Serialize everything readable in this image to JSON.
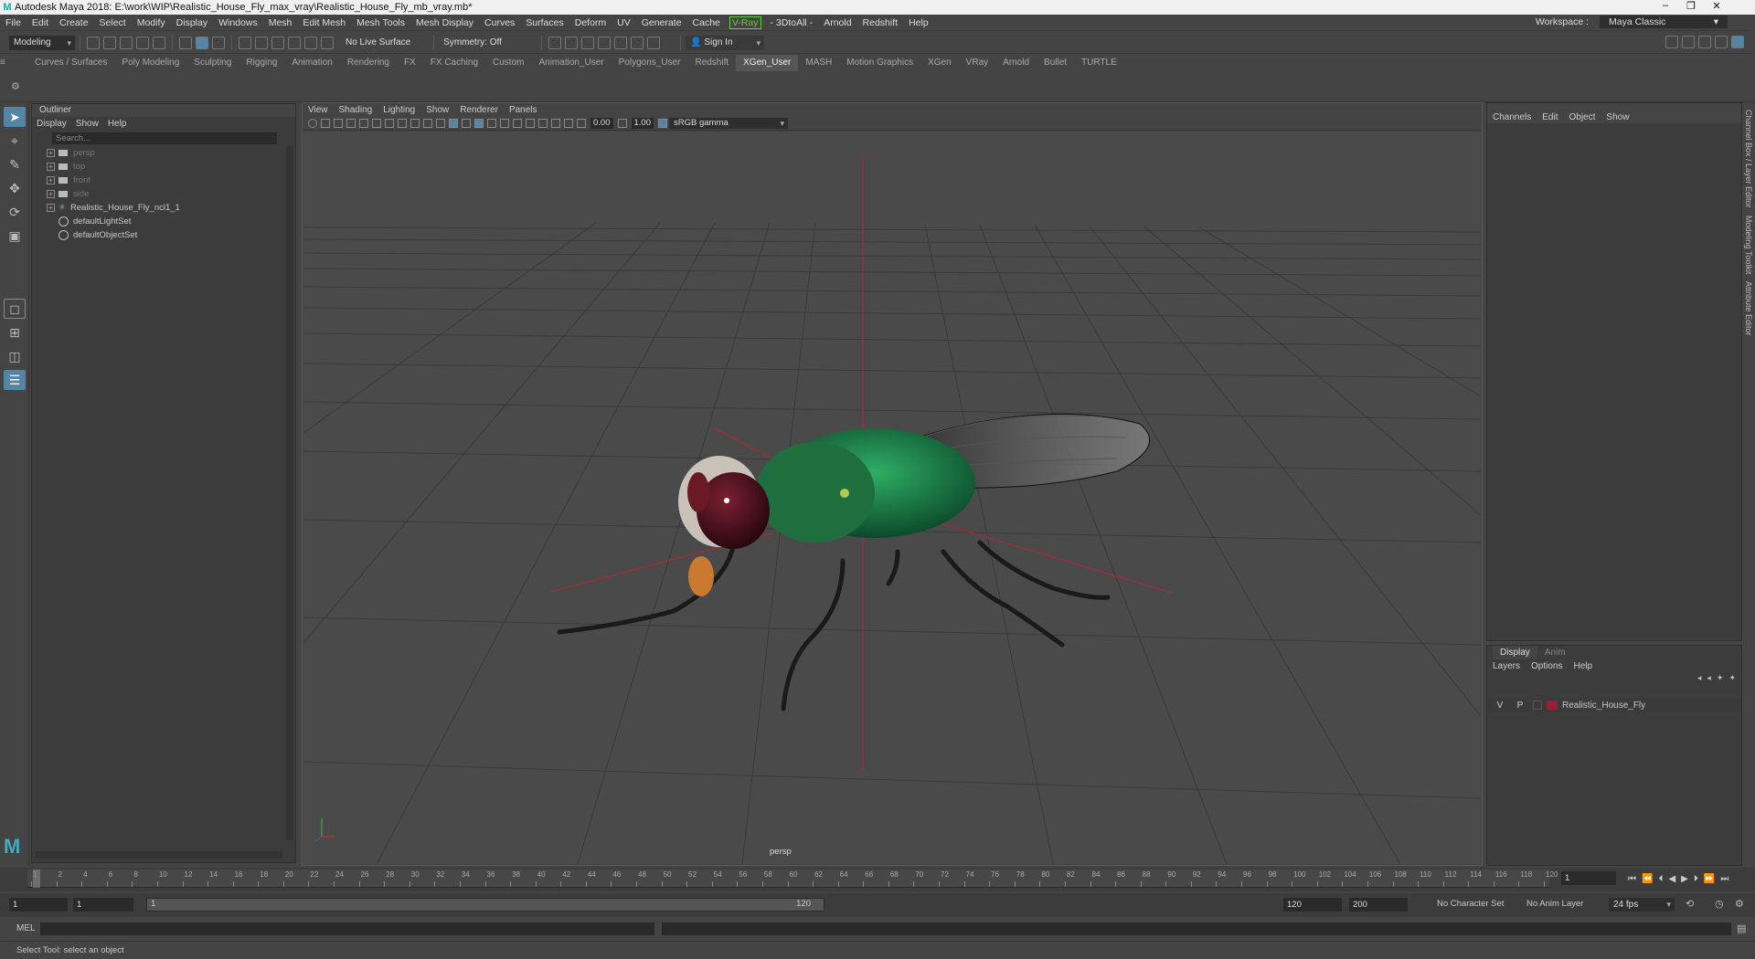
{
  "titlebar": {
    "text": "Autodesk Maya 2018: E:\\work\\WIP\\Realistic_House_Fly_max_vray\\Realistic_House_Fly_mb_vray.mb*"
  },
  "menubar": {
    "items": [
      "File",
      "Edit",
      "Create",
      "Select",
      "Modify",
      "Display",
      "Windows",
      "Mesh",
      "Edit Mesh",
      "Mesh Tools",
      "Mesh Display",
      "Curves",
      "Surfaces",
      "Deform",
      "UV",
      "Generate",
      "Cache"
    ],
    "vray": "V-Ray",
    "items2": [
      "- 3DtoAll -",
      "Arnold",
      "Redshift",
      "Help"
    ],
    "workspace_label": "Workspace :",
    "workspace_value": "Maya Classic"
  },
  "statusline": {
    "mode": "Modeling",
    "live_surface": "No Live Surface",
    "symmetry": "Symmetry: Off",
    "sign_in": "Sign In"
  },
  "shelf": {
    "tabs": [
      "Curves / Surfaces",
      "Poly Modeling",
      "Sculpting",
      "Rigging",
      "Animation",
      "Rendering",
      "FX",
      "FX Caching",
      "Custom",
      "Animation_User",
      "Polygons_User",
      "Redshift",
      "XGen_User",
      "MASH",
      "Motion Graphics",
      "XGen",
      "VRay",
      "Arnold",
      "Bullet",
      "TURTLE"
    ],
    "active": "XGen_User"
  },
  "outliner": {
    "title": "Outliner",
    "menu": [
      "Display",
      "Show",
      "Help"
    ],
    "search_placeholder": "Search...",
    "items": [
      "persp",
      "top",
      "front",
      "side",
      "Realistic_House_Fly_ncl1_1",
      "defaultLightSet",
      "defaultObjectSet"
    ]
  },
  "viewport": {
    "menu": [
      "View",
      "Shading",
      "Lighting",
      "Show",
      "Renderer",
      "Panels"
    ],
    "field1": "0.00",
    "field2": "1.00",
    "color_space": "sRGB gamma",
    "camera_label": "persp"
  },
  "channelbox": {
    "menu": [
      "Channels",
      "Edit",
      "Object",
      "Show"
    ]
  },
  "layers": {
    "tabs": [
      "Display",
      "Anim"
    ],
    "menu": [
      "Layers",
      "Options",
      "Help"
    ],
    "row": {
      "v": "V",
      "p": "P",
      "name": "Realistic_House_Fly",
      "color": "#9b1f33"
    }
  },
  "side_tabs": [
    "Channel Box / Layer Editor",
    "Modeling Toolkit",
    "Attribute Editor"
  ],
  "timeslider": {
    "ticks": [
      "1",
      "2",
      "4",
      "6",
      "8",
      "10",
      "12",
      "14",
      "16",
      "18",
      "20",
      "22",
      "24",
      "26",
      "28",
      "30",
      "32",
      "34",
      "36",
      "38",
      "40",
      "42",
      "44",
      "46",
      "48",
      "50",
      "52",
      "54",
      "56",
      "58",
      "60",
      "62",
      "64",
      "66",
      "68",
      "70",
      "72",
      "74",
      "76",
      "78",
      "80",
      "82",
      "84",
      "86",
      "88",
      "90",
      "92",
      "94",
      "96",
      "98",
      "100",
      "102",
      "104",
      "106",
      "108",
      "110",
      "112",
      "114",
      "116",
      "118",
      "120"
    ],
    "current_frame": "1"
  },
  "range": {
    "start": "1",
    "start2": "1",
    "bar_start": "1",
    "bar_end": "120",
    "end": "120",
    "end2": "200",
    "character_set": "No Character Set",
    "anim_layer": "No Anim Layer",
    "fps": "24 fps"
  },
  "cmdline": {
    "label": "MEL"
  },
  "helpline": {
    "text": "Select Tool: select an object"
  }
}
